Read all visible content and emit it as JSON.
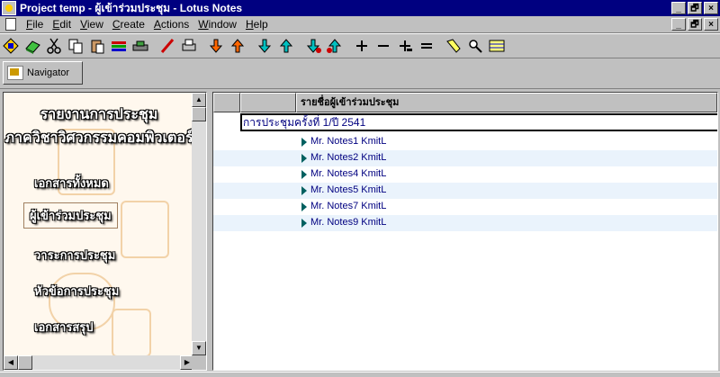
{
  "window": {
    "title": "Project temp - ผู้เข้าร่วมประชุม - Lotus Notes"
  },
  "window_controls": [
    "_",
    "🗗",
    "×"
  ],
  "menu": [
    {
      "accel": "F",
      "rest": "ile"
    },
    {
      "accel": "E",
      "rest": "dit"
    },
    {
      "accel": "V",
      "rest": "iew"
    },
    {
      "accel": "C",
      "rest": "reate"
    },
    {
      "accel": "A",
      "rest": "ctions"
    },
    {
      "accel": "W",
      "rest": "indow"
    },
    {
      "accel": "H",
      "rest": "elp"
    }
  ],
  "toolbar": {
    "navigator_label": "Navigator",
    "icons": [
      "open-database-icon",
      "open-book-icon",
      "scissors-icon",
      "copy-icon",
      "paste-icon",
      "spreadsheet-icon",
      "car-icon",
      "pencil-icon",
      "print-icon",
      "move-down-icon",
      "move-up-icon",
      "next-doc-icon",
      "prev-doc-icon",
      "next-unread-icon",
      "prev-unread-icon",
      "expand-icon",
      "collapse-icon",
      "expand-all-icon",
      "collapse-all-icon",
      "flashlight-icon",
      "search-icon",
      "table-icon"
    ]
  },
  "navigator": {
    "title_line1": "รายงานการประชุม",
    "title_line2": "ภาควิชาวิศวกรรมคอมพิวเตอร์",
    "links": [
      "เอกสารทั้งหมด",
      "ผู้เข้าร่วมประชุม",
      "วาระการประชุม",
      "หัวข้อการประชุม",
      "เอกสารสรุป"
    ],
    "selected_index": 1
  },
  "view": {
    "column_header": "รายชื่อผู้เข้าร่วมประชุม",
    "category": "การประชุมครั้งที่ 1/ปี 2541",
    "rows": [
      "Mr. Notes1 KmitL",
      "Mr. Notes2 KmitL",
      "Mr. Notes4 KmitL",
      "Mr. Notes5 KmitL",
      "Mr. Notes7 KmitL",
      "Mr. Notes9 KmitL"
    ]
  }
}
